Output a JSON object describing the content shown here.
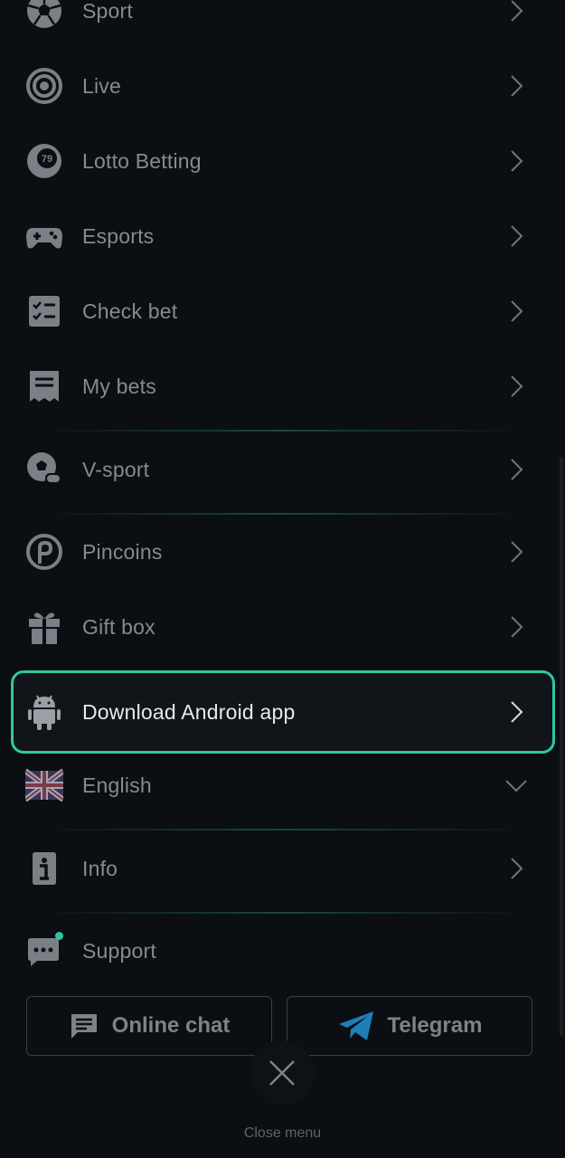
{
  "menu": {
    "items": [
      {
        "label": "Sport",
        "icon": "soccer-ball-icon"
      },
      {
        "label": "Live",
        "icon": "live-target-icon"
      },
      {
        "label": "Lotto Betting",
        "icon": "lotto-ball-icon"
      },
      {
        "label": "Esports",
        "icon": "gamepad-icon"
      },
      {
        "label": "Check bet",
        "icon": "checklist-icon"
      },
      {
        "label": "My bets",
        "icon": "receipt-icon"
      },
      {
        "label": "V-sport",
        "icon": "virtual-sport-icon"
      },
      {
        "label": "Pincoins",
        "icon": "pincoin-icon"
      },
      {
        "label": "Gift box",
        "icon": "gift-icon"
      },
      {
        "label": "Download Android app",
        "icon": "android-icon"
      },
      {
        "label": "English",
        "icon": "uk-flag-icon"
      },
      {
        "label": "Info",
        "icon": "info-icon"
      },
      {
        "label": "Support",
        "icon": "support-chat-icon"
      }
    ]
  },
  "support": {
    "online_chat_label": "Online chat",
    "telegram_label": "Telegram"
  },
  "close": {
    "label": "Close menu"
  },
  "colors": {
    "accent": "#2fc7a2",
    "background": "#0b0e12",
    "text": "#858b90",
    "telegram": "#1d7fb8"
  }
}
